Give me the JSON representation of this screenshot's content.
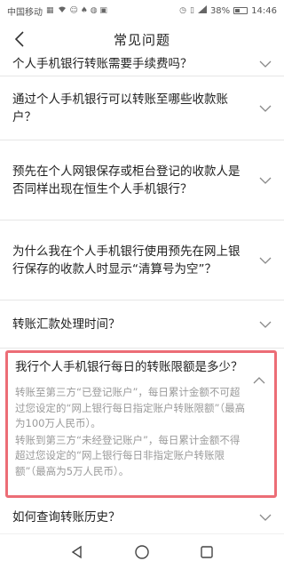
{
  "status_bar": {
    "carrier": "中国移动",
    "battery_percent": "38%",
    "time": "14:46",
    "icons": [
      "sim-icon",
      "wifi-icon",
      "notification-icons",
      "alarm-icon",
      "vibrate-icon",
      "signal-icon",
      "battery-icon"
    ]
  },
  "header": {
    "title": "常见问题",
    "back_icon": "chevron-left-icon"
  },
  "faq": [
    {
      "question": "个人手机银行转账需要手续费吗？",
      "expanded": false
    },
    {
      "question": "通过个人手机银行可以转账至哪些收款账户？",
      "expanded": false
    },
    {
      "question": "预先在个人网银保存或柜台登记的收款人是否同样出现在恒生个人手机银行？",
      "expanded": false
    },
    {
      "question": "为什么我在个人手机银行使用预先在网上银行保存的收款人时显示“清算号为空”？",
      "expanded": false
    },
    {
      "question": "转账汇款处理时间？",
      "expanded": false
    },
    {
      "question": "我行个人手机银行每日的转账限额是多少？",
      "expanded": true,
      "answer": [
        "转账至第三方“已登记账户”，每日累计金额不可超过您设定的“网上银行每日指定账户转账限额”（最高为100万人民币）。",
        "转账到第三方“未经登记账户”，每日累计金额不得超过您设定的“网上银行每日非指定账户转账限额”（最高为5万人民币）。"
      ]
    },
    {
      "question": "如何查询转账历史？",
      "expanded": false
    }
  ],
  "colors": {
    "highlight_border": "#ec6d76",
    "answer_text": "#9a9a9a"
  },
  "nav_bar": {
    "icons": [
      "back-triangle-icon",
      "home-circle-icon",
      "recents-square-icon"
    ]
  }
}
